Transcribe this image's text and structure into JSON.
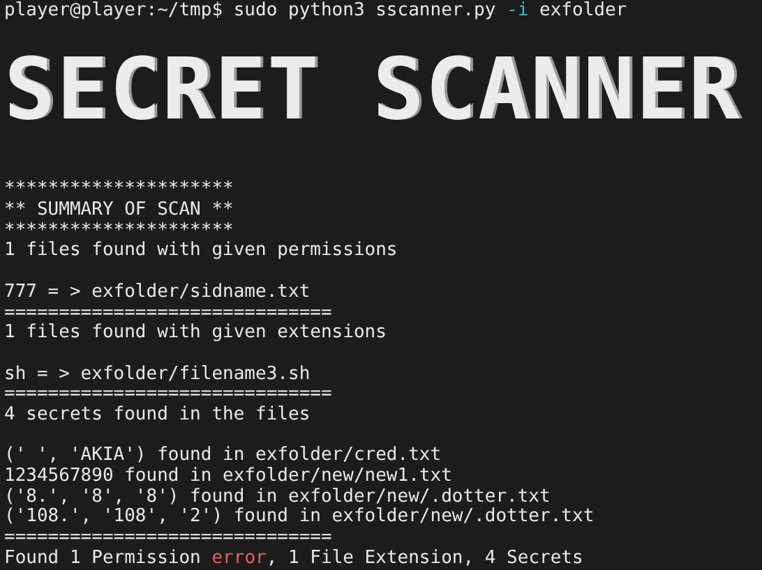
{
  "command": {
    "prompt": "player@player:~/tmp$",
    "program": "sudo python3 sscanner.py",
    "flag": "-i",
    "argument": "exfolder"
  },
  "banner": "SECRET SCANNER",
  "lines": [
    {
      "kind": "blank"
    },
    {
      "kind": "text",
      "segments": [
        {
          "text": "*********************",
          "kind": "plain"
        }
      ]
    },
    {
      "kind": "text",
      "segments": [
        {
          "text": "** SUMMARY OF SCAN **",
          "kind": "plain"
        }
      ]
    },
    {
      "kind": "text",
      "segments": [
        {
          "text": "*********************",
          "kind": "plain"
        }
      ]
    },
    {
      "kind": "text",
      "segments": [
        {
          "text": "1 files found with given permissions",
          "kind": "plain"
        }
      ]
    },
    {
      "kind": "blank"
    },
    {
      "kind": "text",
      "segments": [
        {
          "text": "777 = > exfolder/sidname.txt",
          "kind": "plain"
        }
      ]
    },
    {
      "kind": "text",
      "segments": [
        {
          "text": "==============================",
          "kind": "plain"
        }
      ]
    },
    {
      "kind": "text",
      "segments": [
        {
          "text": "1 files found with given extensions",
          "kind": "plain"
        }
      ]
    },
    {
      "kind": "blank"
    },
    {
      "kind": "text",
      "segments": [
        {
          "text": "sh = > exfolder/filename3.sh",
          "kind": "plain"
        }
      ]
    },
    {
      "kind": "text",
      "segments": [
        {
          "text": "==============================",
          "kind": "plain"
        }
      ]
    },
    {
      "kind": "text",
      "segments": [
        {
          "text": "4 secrets found in the files",
          "kind": "plain"
        }
      ]
    },
    {
      "kind": "blank"
    },
    {
      "kind": "text",
      "segments": [
        {
          "text": "(' ', 'AKIA') found in exfolder/cred.txt",
          "kind": "plain"
        }
      ]
    },
    {
      "kind": "text",
      "segments": [
        {
          "text": "1234567890 found in exfolder/new/new1.txt",
          "kind": "plain"
        }
      ]
    },
    {
      "kind": "text",
      "segments": [
        {
          "text": "('8.', '8', '8') found in exfolder/new/.dotter.txt",
          "kind": "plain"
        }
      ]
    },
    {
      "kind": "text",
      "segments": [
        {
          "text": "('108.', '108', '2') found in exfolder/new/.dotter.txt",
          "kind": "plain"
        }
      ]
    },
    {
      "kind": "text",
      "segments": [
        {
          "text": "==============================",
          "kind": "plain"
        }
      ]
    },
    {
      "kind": "text",
      "segments": [
        {
          "text": "Found 1 Permission ",
          "kind": "plain"
        },
        {
          "text": "error",
          "kind": "error"
        },
        {
          "text": ", 1 File Extension, 4 Secrets",
          "kind": "plain"
        }
      ]
    }
  ]
}
